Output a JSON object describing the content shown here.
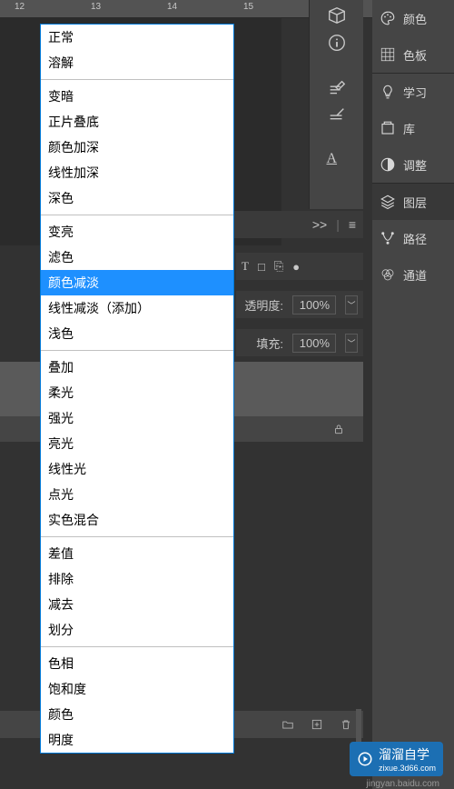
{
  "ruler": {
    "ticks": [
      "12",
      "13",
      "14",
      "15"
    ]
  },
  "right_panels": [
    {
      "icon": "palette-icon",
      "label": "颜色"
    },
    {
      "icon": "swatches-icon",
      "label": "色板"
    },
    {
      "icon": "bulb-icon",
      "label": "学习"
    },
    {
      "icon": "library-icon",
      "label": "库"
    },
    {
      "icon": "adjust-icon",
      "label": "调整"
    },
    {
      "icon": "layers-icon",
      "label": "图层"
    },
    {
      "icon": "paths-icon",
      "label": "路径"
    },
    {
      "icon": "channels-icon",
      "label": "通道"
    }
  ],
  "tool_icons": [
    "box3d-icon",
    "info-icon",
    "spacer",
    "brush-settings-icon",
    "brush-icon",
    "spacer",
    "text-icon"
  ],
  "panel_header": {
    "expand": ">>",
    "menu": "≡"
  },
  "tool_row1": [
    "T",
    "□",
    "⎘",
    "●"
  ],
  "opacity": {
    "label": "透明度:",
    "value": "100%"
  },
  "fill": {
    "label": "填充:",
    "value": "100%"
  },
  "blend_modes": {
    "selected": "颜色减淡",
    "groups": [
      [
        "正常",
        "溶解"
      ],
      [
        "变暗",
        "正片叠底",
        "颜色加深",
        "线性加深",
        "深色"
      ],
      [
        "变亮",
        "滤色",
        "颜色减淡",
        "线性减淡（添加）",
        "浅色"
      ],
      [
        "叠加",
        "柔光",
        "强光",
        "亮光",
        "线性光",
        "点光",
        "实色混合"
      ],
      [
        "差值",
        "排除",
        "减去",
        "划分"
      ],
      [
        "色相",
        "饱和度",
        "颜色",
        "明度"
      ]
    ]
  },
  "watermark": {
    "brand": "溜溜自学",
    "sub": "zixue",
    "url": "jingyan.baidu.com"
  }
}
